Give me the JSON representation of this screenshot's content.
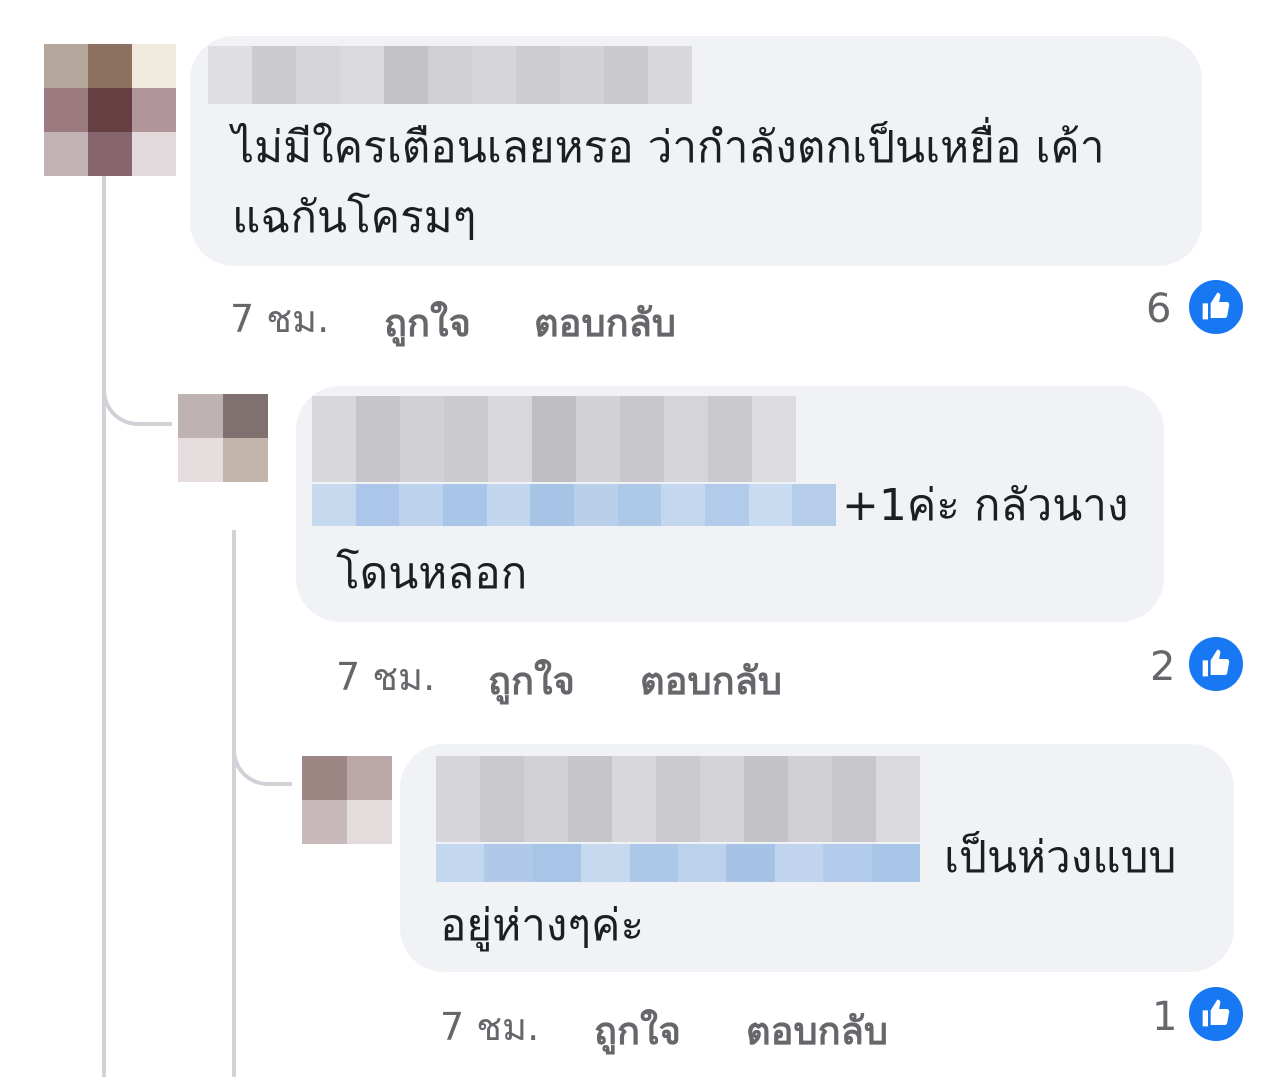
{
  "comments": [
    {
      "text_line1": "ไม่มีใครเตือนเลยหรอ ว่ากำลังตกเป็นเหยื่อ เค้า",
      "text_line2": "แฉกันโครมๆ",
      "time": "7 ชม.",
      "like_label": "ถูกใจ",
      "reply_label": "ตอบกลับ",
      "reaction_count": "6",
      "reaction_icon": "thumbs-up-icon"
    },
    {
      "text_line1_suffix": "+1ค่ะ กลัวนาง",
      "text_line2": "โดนหลอก",
      "time": "7 ชม.",
      "like_label": "ถูกใจ",
      "reply_label": "ตอบกลับ",
      "reaction_count": "2",
      "reaction_icon": "thumbs-up-icon"
    },
    {
      "text_line1_suffix": "เป็นห่วงแบบ",
      "text_line2": "อยู่ห่างๆค่ะ",
      "time": "7 ชม.",
      "like_label": "ถูกใจ",
      "reply_label": "ตอบกลับ",
      "reaction_count": "1",
      "reaction_icon": "thumbs-up-icon"
    }
  ],
  "colors": {
    "bubble": "#f0f2f5",
    "like_blue": "#1877f2",
    "meta_gray": "#65676b",
    "thread_line": "#cfd2d6"
  }
}
